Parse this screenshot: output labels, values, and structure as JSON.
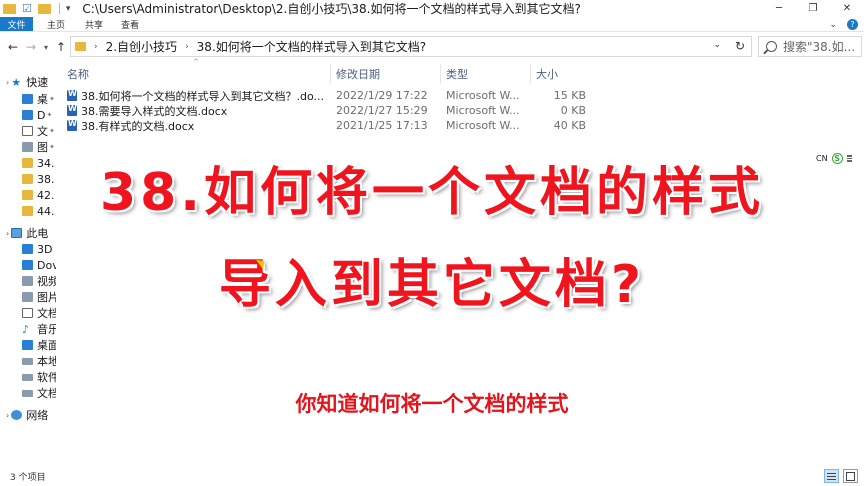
{
  "window": {
    "title": "C:\\Users\\Administrator\\Desktop\\2.自创小技巧\\38.如何将一个文档的样式导入到其它文档?",
    "minimize_icon": "minimize-icon",
    "maximize_icon": "restore-icon",
    "close_icon": "close-icon"
  },
  "ribbon": {
    "tabs": [
      "文件",
      "主页",
      "共享",
      "查看"
    ]
  },
  "address": {
    "crumbs": [
      "2.自创小技巧",
      "38.如何将一个文档的样式导入到其它文档?"
    ]
  },
  "search": {
    "placeholder": "搜索\"38.如..."
  },
  "navpane": {
    "items": [
      {
        "label": "快速",
        "icon": "star-icon"
      },
      {
        "label": "桌",
        "icon": "desktop-icon"
      },
      {
        "label": "D",
        "icon": "download-icon"
      },
      {
        "label": "文",
        "icon": "document-icon"
      },
      {
        "label": "图",
        "icon": "picture-icon"
      },
      {
        "label": "34.",
        "icon": "folder-icon"
      },
      {
        "label": "38.",
        "icon": "folder-icon"
      },
      {
        "label": "42.",
        "icon": "folder-icon"
      },
      {
        "label": "44.",
        "icon": "folder-icon"
      },
      {
        "label": "此电",
        "icon": "pc-icon"
      },
      {
        "label": "3D",
        "icon": "3d-objects-icon"
      },
      {
        "label": "Dov",
        "icon": "download-icon"
      },
      {
        "label": "视频",
        "icon": "video-icon"
      },
      {
        "label": "图片",
        "icon": "picture-icon"
      },
      {
        "label": "文档",
        "icon": "document-icon"
      },
      {
        "label": "音乐",
        "icon": "music-icon"
      },
      {
        "label": "桌面",
        "icon": "desktop-icon"
      },
      {
        "label": "本地",
        "icon": "drive-icon"
      },
      {
        "label": "软件",
        "icon": "drive-icon"
      },
      {
        "label": "文档",
        "icon": "drive-icon"
      },
      {
        "label": "网络",
        "icon": "network-icon"
      }
    ]
  },
  "columns": {
    "name": "名称",
    "date": "修改日期",
    "type": "类型",
    "size": "大小"
  },
  "files": [
    {
      "name": "38.如何将一个文档的样式导入到其它文档？.do...",
      "date": "2022/1/29 17:22",
      "type": "Microsoft W...",
      "size": "15 KB"
    },
    {
      "name": "38.需要导入样式的文档.docx",
      "date": "2022/1/27 15:29",
      "type": "Microsoft W...",
      "size": "0 KB"
    },
    {
      "name": "38.有样式的文档.docx",
      "date": "2021/1/25 17:13",
      "type": "Microsoft W...",
      "size": "40 KB"
    }
  ],
  "ime": {
    "lang": "CN",
    "icon": "sogou-ime-icon"
  },
  "overlay": {
    "caption_line1": "38.如何将一个文档的样式",
    "caption_line2": "导入到其它文档?",
    "subtitle": "你知道如何将一个文档的样式"
  },
  "status": {
    "item_count": "3 个项目"
  },
  "colors": {
    "accent": "#1979ca",
    "caption_red": "#f0141e",
    "folder": "#e8b73d"
  }
}
